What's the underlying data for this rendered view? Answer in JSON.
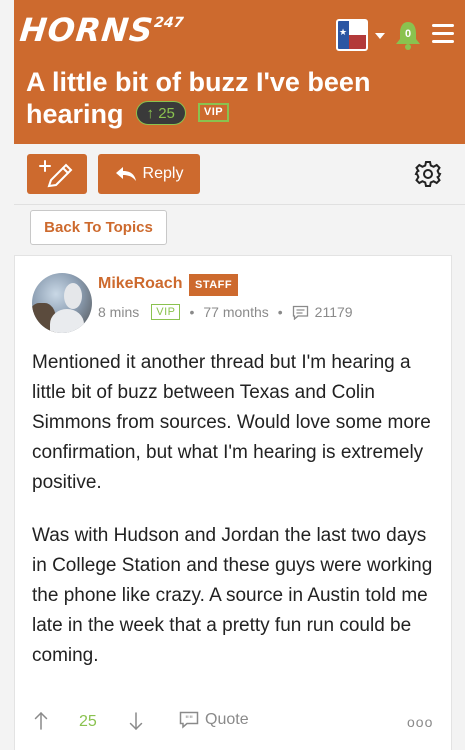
{
  "header": {
    "logo_text": "HORNS",
    "logo_superscript": "247",
    "notification_count": "0",
    "brand_color": "#cd6a2e"
  },
  "thread": {
    "title": "A little bit of buzz I've been hearing",
    "vote_count": "25",
    "vip_label": "VIP"
  },
  "toolbar": {
    "reply_label": "Reply"
  },
  "nav": {
    "back_label": "Back To Topics"
  },
  "post": {
    "author": "MikeRoach",
    "staff_label": "STAFF",
    "posted_ago": "8 mins",
    "vip_label": "VIP",
    "member_for": "77 months",
    "message_count": "21179",
    "paragraphs": [
      "Mentioned it another thread but I'm hearing a little bit of buzz between Texas and Colin Simmons from sources. Would love some more confirmation, but what I'm hearing is extremely positive.",
      "Was with Hudson and Jordan the last two days in College Station and these guys were working the phone like crazy. A source in Austin told me late in the week that a pretty fun run could be coming."
    ],
    "vote_count": "25",
    "quote_label": "Quote",
    "more_label": "ooo"
  },
  "icons": {
    "flag": "texas-flag-icon",
    "bell": "bell-icon",
    "menu": "hamburger-menu-icon",
    "compose": "pen-plus-icon",
    "reply": "reply-arrow-icon",
    "settings": "gear-icon",
    "upvote": "arrow-up-icon",
    "downvote": "arrow-down-icon",
    "quote": "quote-bubble-icon",
    "messages": "message-icon"
  }
}
